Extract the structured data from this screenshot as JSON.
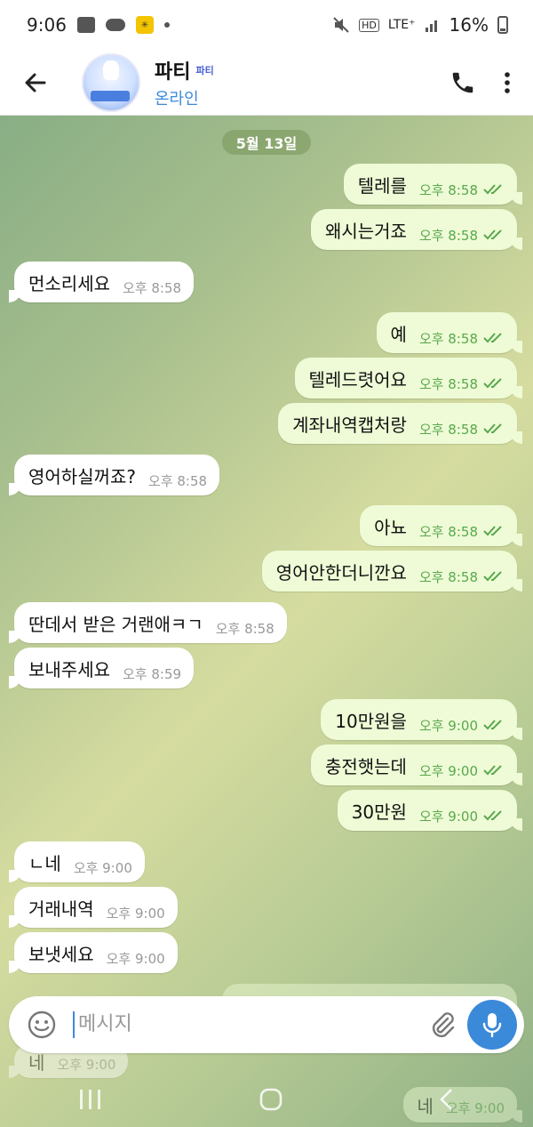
{
  "status_bar": {
    "time": "9:06",
    "network": "LTE⁺",
    "battery": "16%"
  },
  "header": {
    "title": "파티",
    "badge_text": "파티",
    "subtitle": "온라인",
    "avatar_text": "파티 고객센터"
  },
  "date_divider": "5월 13일",
  "messages": [
    {
      "side": "out",
      "text": "텔레를",
      "time": "오후 8:58",
      "read": true
    },
    {
      "side": "out",
      "text": "왜시는거죠",
      "time": "오후 8:58",
      "read": true
    },
    {
      "side": "in",
      "text": "먼소리세요",
      "time": "오후 8:58"
    },
    {
      "side": "out",
      "text": "예",
      "time": "오후 8:58",
      "read": true
    },
    {
      "side": "out",
      "text": "텔레드렷어요",
      "time": "오후 8:58",
      "read": true
    },
    {
      "side": "out",
      "text": "계좌내역캡처랑",
      "time": "오후 8:58",
      "read": true
    },
    {
      "side": "in",
      "text": "영어하실꺼죠?",
      "time": "오후 8:58"
    },
    {
      "side": "out",
      "text": "아뇨",
      "time": "오후 8:58",
      "read": true
    },
    {
      "side": "out",
      "text": "영어안한더니깐요",
      "time": "오후 8:58",
      "read": true
    },
    {
      "side": "in",
      "text": "딴데서 받은 거랜애ㅋㄱ",
      "time": "오후 8:58"
    },
    {
      "side": "in",
      "text": "보내주세요",
      "time": "오후 8:59"
    },
    {
      "side": "out",
      "text": "10만원을",
      "time": "오후 9:00",
      "read": true
    },
    {
      "side": "out",
      "text": "충전햇는데",
      "time": "오후 9:00",
      "read": true
    },
    {
      "side": "out",
      "text": "30만원",
      "time": "오후 9:00",
      "read": true
    },
    {
      "side": "in",
      "text": "ㄴ네",
      "time": "오후 9:00"
    },
    {
      "side": "in",
      "text": "거래내역",
      "time": "오후 9:00"
    },
    {
      "side": "in",
      "text": "보냇세요",
      "time": "오후 9:00"
    }
  ],
  "hidden_messages": [
    {
      "side": "in",
      "text": "네",
      "time": "오후 9:00"
    },
    {
      "side": "out",
      "text": "네",
      "time": "오후 9:00"
    }
  ],
  "input": {
    "placeholder": "메시지"
  },
  "colors": {
    "accent": "#3b8ad9",
    "outgoing_bubble": "#eefbd6",
    "incoming_bubble": "#ffffff",
    "outgoing_time": "#5aa84e"
  }
}
